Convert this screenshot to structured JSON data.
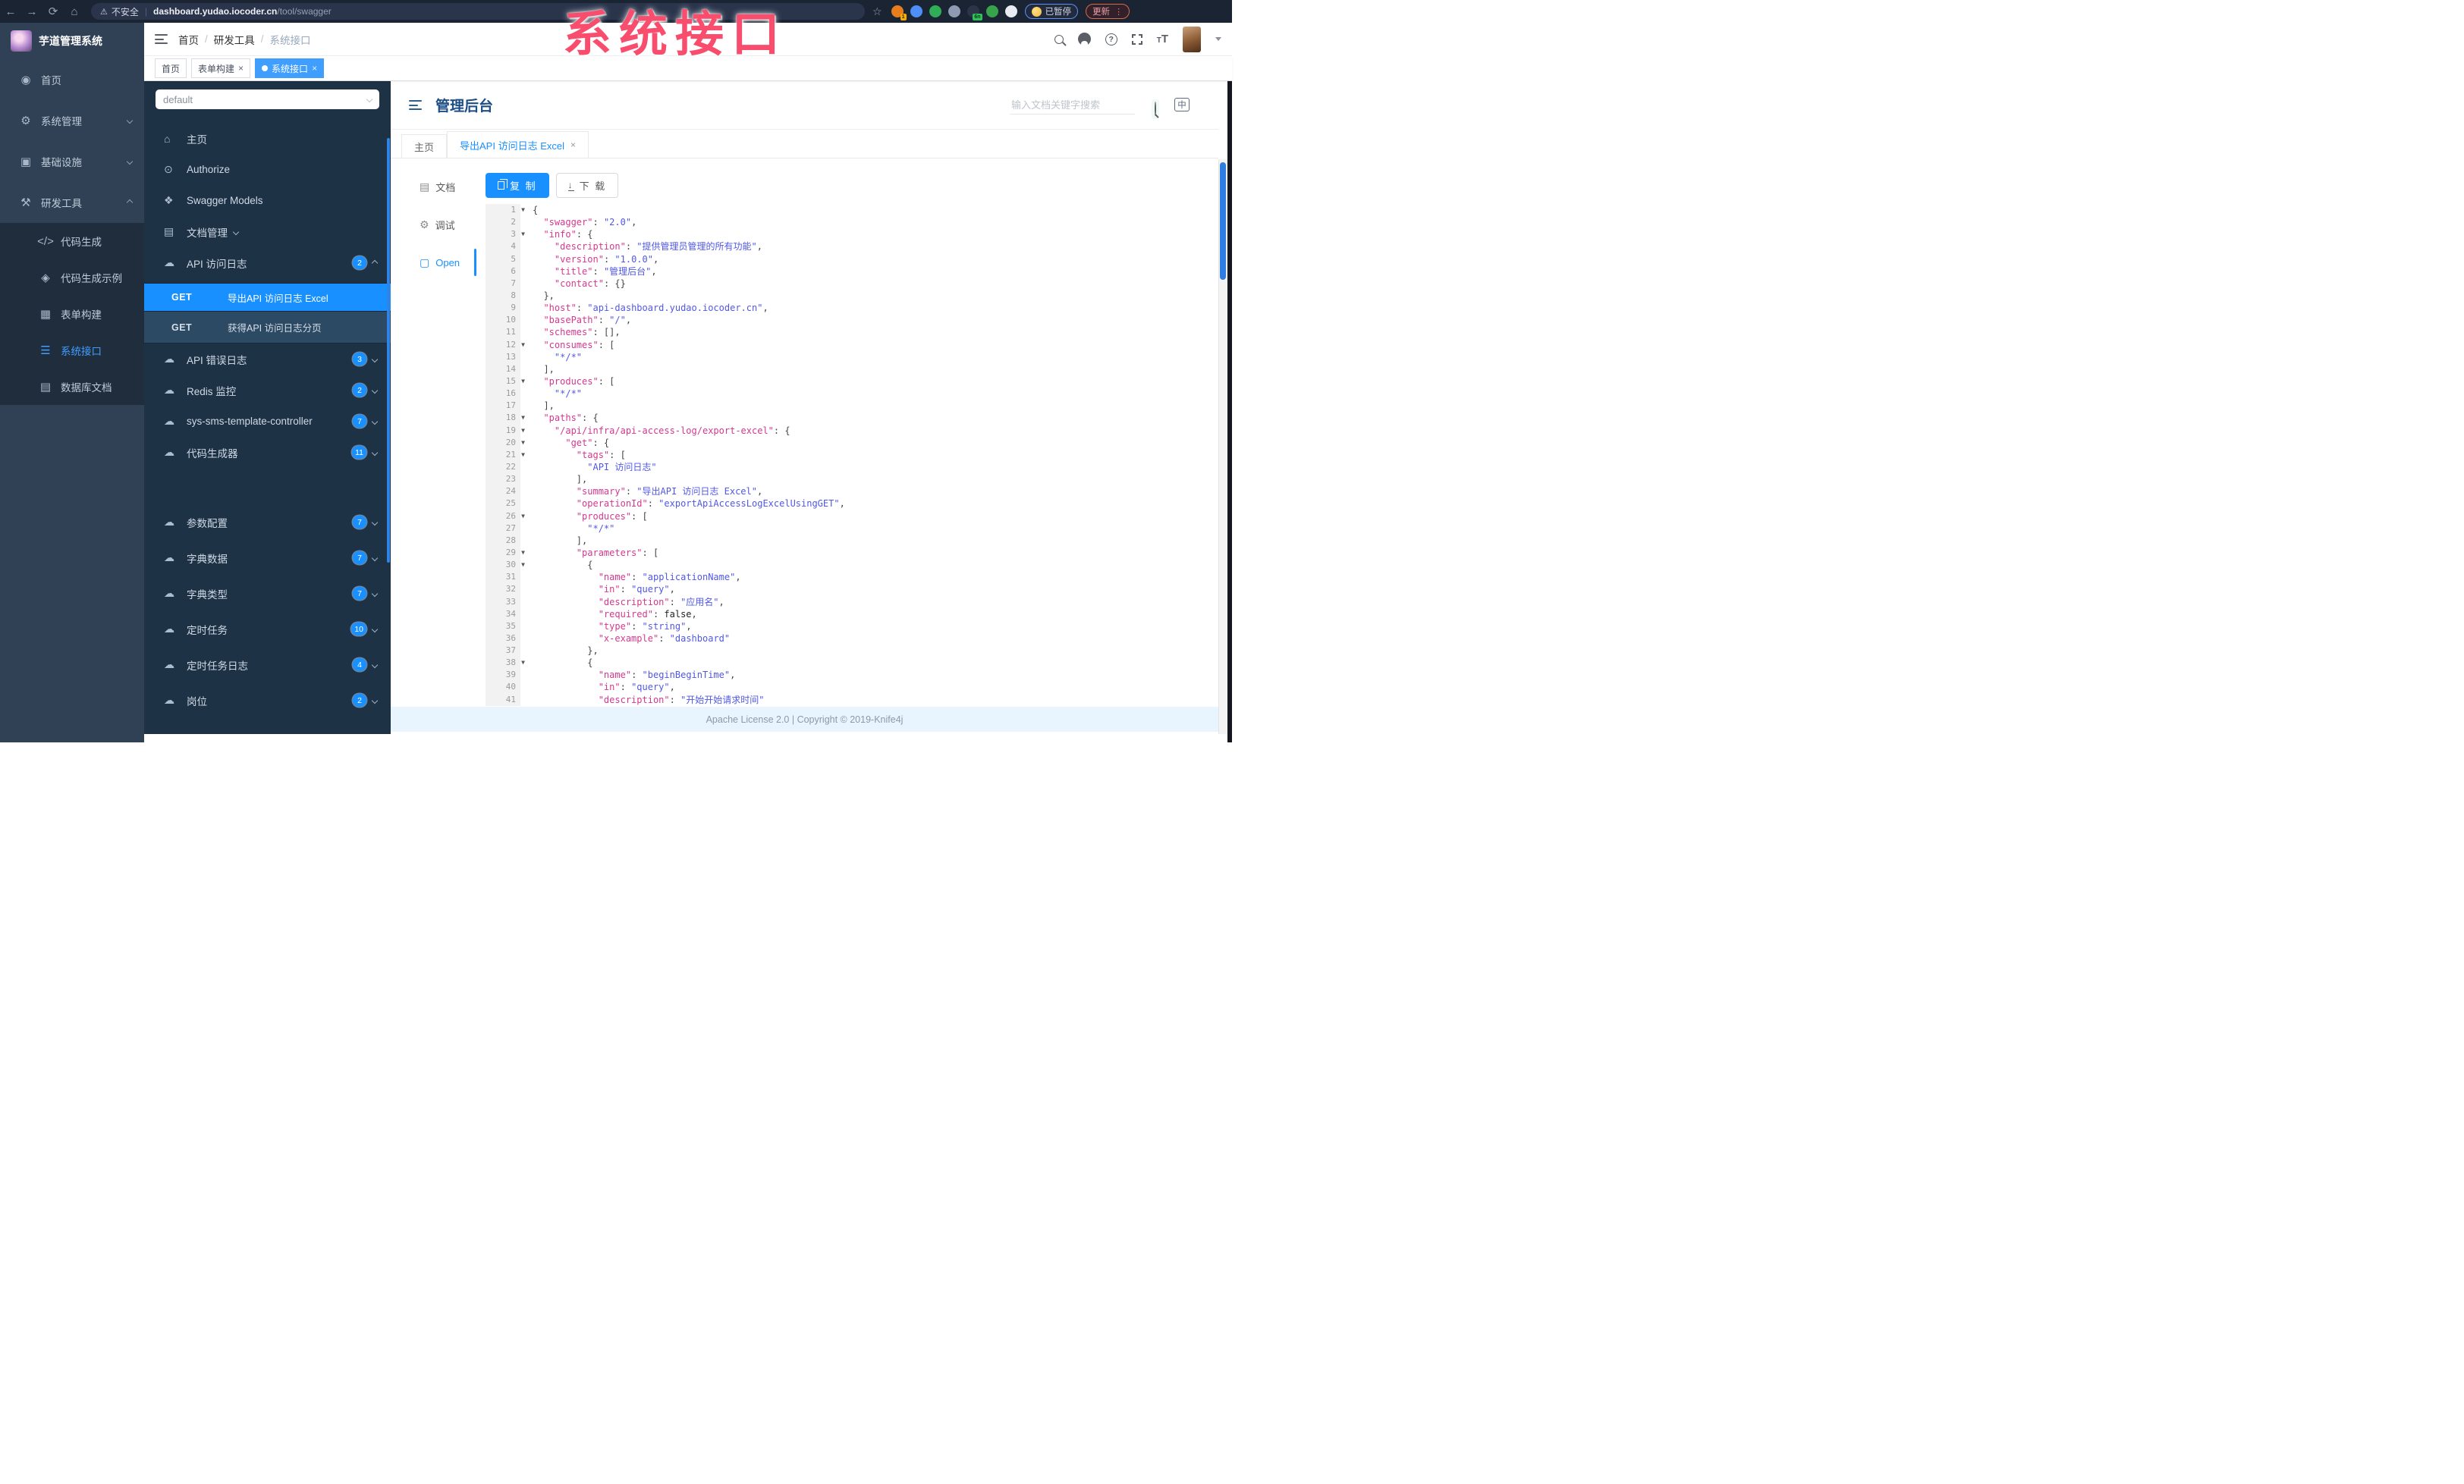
{
  "watermark": {
    "text": "系统接口",
    "color": "#f94d6e"
  },
  "browser": {
    "security_label": "不安全",
    "url_host": "dashboard.yudao.iocoder.cn",
    "url_path": "/tool/swagger",
    "paused_label": "已暂停",
    "update_label": "更新",
    "extensions": [
      {
        "name": "extension-orange",
        "color": "#e87d1e",
        "badge": "1",
        "badge_style": "orange"
      },
      {
        "name": "extension-drop",
        "color": "#4f8ef7"
      },
      {
        "name": "extension-shield-green",
        "color": "#2fae57"
      },
      {
        "name": "extension-grid",
        "color": "#8e9bb3"
      },
      {
        "name": "extension-dark",
        "color": "#2c3547",
        "badge": "6n",
        "badge_style": "green"
      },
      {
        "name": "extension-leaf",
        "color": "#37a34a"
      },
      {
        "name": "extension-paw",
        "color": "#e8ecf2"
      }
    ]
  },
  "app": {
    "logo_title": "芋道管理系统",
    "sidebar": [
      {
        "label": "首页",
        "icon": "dashboard-icon",
        "glyph": "◉"
      },
      {
        "label": "系统管理",
        "icon": "gear-icon",
        "glyph": "⚙",
        "chevron": "down"
      },
      {
        "label": "基础设施",
        "icon": "monitor-icon",
        "glyph": "▣",
        "chevron": "down"
      },
      {
        "label": "研发工具",
        "icon": "toolbox-icon",
        "glyph": "⚒",
        "chevron": "up",
        "children": [
          {
            "label": "代码生成",
            "icon": "code-icon",
            "glyph": "</>"
          },
          {
            "label": "代码生成示例",
            "icon": "shield-check-icon",
            "glyph": "◈"
          },
          {
            "label": "表单构建",
            "icon": "form-grid-icon",
            "glyph": "▦"
          },
          {
            "label": "系统接口",
            "icon": "api-list-icon",
            "glyph": "☰",
            "active": true
          },
          {
            "label": "数据库文档",
            "icon": "table-icon",
            "glyph": "▤"
          }
        ]
      }
    ],
    "breadcrumb": [
      "首页",
      "研发工具",
      "系统接口"
    ],
    "view_tabs": [
      {
        "label": "首页",
        "closable": false,
        "active": false
      },
      {
        "label": "表单构建",
        "closable": true,
        "active": false
      },
      {
        "label": "系统接口",
        "closable": true,
        "active": true
      }
    ]
  },
  "knife4j": {
    "group_select": "default",
    "menu": [
      {
        "label": "主页",
        "icon": "home-icon",
        "glyph": "⌂"
      },
      {
        "label": "Authorize",
        "icon": "lock-icon",
        "glyph": "⊙"
      },
      {
        "label": "Swagger Models",
        "icon": "models-icon",
        "glyph": "❖"
      },
      {
        "label": "文档管理",
        "icon": "doc-manage-icon",
        "glyph": "▤",
        "chevron": "down"
      },
      {
        "label": "API 访问日志",
        "icon": "cloud-icon",
        "glyph": "☁",
        "badge": "2",
        "chevron": "up"
      }
    ],
    "operations": [
      {
        "method": "GET",
        "label": "导出API 访问日志 Excel",
        "selected": true
      },
      {
        "method": "GET",
        "label": "获得API 访问日志分页",
        "selected": false
      }
    ],
    "api_groups": [
      {
        "label": "API 错误日志",
        "badge": "3"
      },
      {
        "label": "Redis 监控",
        "badge": "2"
      },
      {
        "label": "sys-sms-template-controller",
        "badge": "7"
      },
      {
        "label": "代码生成器",
        "badge": "11"
      },
      {
        "label": "参数配置",
        "badge": "7"
      },
      {
        "label": "字典数据",
        "badge": "7"
      },
      {
        "label": "字典类型",
        "badge": "7"
      },
      {
        "label": "定时任务",
        "badge": "10"
      },
      {
        "label": "定时任务日志",
        "badge": "4"
      },
      {
        "label": "岗位",
        "badge": "2"
      }
    ],
    "doc_header": {
      "title": "管理后台",
      "search_placeholder": "输入文档关键字搜索",
      "lang_label": "中"
    },
    "doc_tabs": [
      {
        "label": "主页",
        "closable": false,
        "active": false
      },
      {
        "label": "导出API 访问日志 Excel",
        "closable": true,
        "active": true
      }
    ],
    "mini_tabs": [
      {
        "label": "文档",
        "icon": "doc-icon",
        "glyph": "▤",
        "active": false
      },
      {
        "label": "调试",
        "icon": "debug-icon",
        "glyph": "⚙",
        "active": false
      },
      {
        "label": "Open",
        "icon": "open-file-icon",
        "glyph": "▢",
        "active": true
      }
    ],
    "toolbar": {
      "copy_label": "复 制",
      "download_label": "下 载"
    },
    "footer": "Apache License 2.0 | Copyright © 2019-Knife4j"
  },
  "editor": {
    "lines": [
      {
        "n": 1,
        "f": 1,
        "p": [
          [
            "p",
            "{"
          ]
        ]
      },
      {
        "n": 2,
        "p": [
          [
            "p",
            "  "
          ],
          [
            "k",
            "\"swagger\""
          ],
          [
            "p",
            ": "
          ],
          [
            "s",
            "\"2.0\""
          ],
          [
            "p",
            ","
          ]
        ]
      },
      {
        "n": 3,
        "f": 1,
        "p": [
          [
            "p",
            "  "
          ],
          [
            "k",
            "\"info\""
          ],
          [
            "p",
            ": {"
          ]
        ]
      },
      {
        "n": 4,
        "p": [
          [
            "p",
            "    "
          ],
          [
            "k",
            "\"description\""
          ],
          [
            "p",
            ": "
          ],
          [
            "s",
            "\"提供管理员管理的所有功能\""
          ],
          [
            "p",
            ","
          ]
        ]
      },
      {
        "n": 5,
        "p": [
          [
            "p",
            "    "
          ],
          [
            "k",
            "\"version\""
          ],
          [
            "p",
            ": "
          ],
          [
            "s",
            "\"1.0.0\""
          ],
          [
            "p",
            ","
          ]
        ]
      },
      {
        "n": 6,
        "p": [
          [
            "p",
            "    "
          ],
          [
            "k",
            "\"title\""
          ],
          [
            "p",
            ": "
          ],
          [
            "s",
            "\"管理后台\""
          ],
          [
            "p",
            ","
          ]
        ]
      },
      {
        "n": 7,
        "p": [
          [
            "p",
            "    "
          ],
          [
            "k",
            "\"contact\""
          ],
          [
            "p",
            ": {}"
          ]
        ]
      },
      {
        "n": 8,
        "p": [
          [
            "p",
            "  },"
          ]
        ]
      },
      {
        "n": 9,
        "p": [
          [
            "p",
            "  "
          ],
          [
            "k",
            "\"host\""
          ],
          [
            "p",
            ": "
          ],
          [
            "s",
            "\"api-dashboard.yudao.iocoder.cn\""
          ],
          [
            "p",
            ","
          ]
        ]
      },
      {
        "n": 10,
        "p": [
          [
            "p",
            "  "
          ],
          [
            "k",
            "\"basePath\""
          ],
          [
            "p",
            ": "
          ],
          [
            "s",
            "\"/\""
          ],
          [
            "p",
            ","
          ]
        ]
      },
      {
        "n": 11,
        "p": [
          [
            "p",
            "  "
          ],
          [
            "k",
            "\"schemes\""
          ],
          [
            "p",
            ": [],"
          ]
        ]
      },
      {
        "n": 12,
        "f": 1,
        "p": [
          [
            "p",
            "  "
          ],
          [
            "k",
            "\"consumes\""
          ],
          [
            "p",
            ": ["
          ]
        ]
      },
      {
        "n": 13,
        "p": [
          [
            "p",
            "    "
          ],
          [
            "s",
            "\"*/*\""
          ]
        ]
      },
      {
        "n": 14,
        "p": [
          [
            "p",
            "  ],"
          ]
        ]
      },
      {
        "n": 15,
        "f": 1,
        "p": [
          [
            "p",
            "  "
          ],
          [
            "k",
            "\"produces\""
          ],
          [
            "p",
            ": ["
          ]
        ]
      },
      {
        "n": 16,
        "p": [
          [
            "p",
            "    "
          ],
          [
            "s",
            "\"*/*\""
          ]
        ]
      },
      {
        "n": 17,
        "p": [
          [
            "p",
            "  ],"
          ]
        ]
      },
      {
        "n": 18,
        "f": 1,
        "p": [
          [
            "p",
            "  "
          ],
          [
            "k",
            "\"paths\""
          ],
          [
            "p",
            ": {"
          ]
        ]
      },
      {
        "n": 19,
        "f": 1,
        "p": [
          [
            "p",
            "    "
          ],
          [
            "k",
            "\"/api/infra/api-access-log/export-excel\""
          ],
          [
            "p",
            ": {"
          ]
        ]
      },
      {
        "n": 20,
        "f": 1,
        "p": [
          [
            "p",
            "      "
          ],
          [
            "k",
            "\"get\""
          ],
          [
            "p",
            ": {"
          ]
        ]
      },
      {
        "n": 21,
        "f": 1,
        "p": [
          [
            "p",
            "        "
          ],
          [
            "k",
            "\"tags\""
          ],
          [
            "p",
            ": ["
          ]
        ]
      },
      {
        "n": 22,
        "p": [
          [
            "p",
            "          "
          ],
          [
            "s",
            "\"API 访问日志\""
          ]
        ]
      },
      {
        "n": 23,
        "p": [
          [
            "p",
            "        ],"
          ]
        ]
      },
      {
        "n": 24,
        "p": [
          [
            "p",
            "        "
          ],
          [
            "k",
            "\"summary\""
          ],
          [
            "p",
            ": "
          ],
          [
            "s",
            "\"导出API 访问日志 Excel\""
          ],
          [
            "p",
            ","
          ]
        ]
      },
      {
        "n": 25,
        "p": [
          [
            "p",
            "        "
          ],
          [
            "k",
            "\"operationId\""
          ],
          [
            "p",
            ": "
          ],
          [
            "s",
            "\"exportApiAccessLogExcelUsingGET\""
          ],
          [
            "p",
            ","
          ]
        ]
      },
      {
        "n": 26,
        "f": 1,
        "p": [
          [
            "p",
            "        "
          ],
          [
            "k",
            "\"produces\""
          ],
          [
            "p",
            ": ["
          ]
        ]
      },
      {
        "n": 27,
        "p": [
          [
            "p",
            "          "
          ],
          [
            "s",
            "\"*/*\""
          ]
        ]
      },
      {
        "n": 28,
        "p": [
          [
            "p",
            "        ],"
          ]
        ]
      },
      {
        "n": 29,
        "f": 1,
        "p": [
          [
            "p",
            "        "
          ],
          [
            "k",
            "\"parameters\""
          ],
          [
            "p",
            ": ["
          ]
        ]
      },
      {
        "n": 30,
        "f": 1,
        "p": [
          [
            "p",
            "          {"
          ]
        ]
      },
      {
        "n": 31,
        "p": [
          [
            "p",
            "            "
          ],
          [
            "k",
            "\"name\""
          ],
          [
            "p",
            ": "
          ],
          [
            "s",
            "\"applicationName\""
          ],
          [
            "p",
            ","
          ]
        ]
      },
      {
        "n": 32,
        "p": [
          [
            "p",
            "            "
          ],
          [
            "k",
            "\"in\""
          ],
          [
            "p",
            ": "
          ],
          [
            "s",
            "\"query\""
          ],
          [
            "p",
            ","
          ]
        ]
      },
      {
        "n": 33,
        "p": [
          [
            "p",
            "            "
          ],
          [
            "k",
            "\"description\""
          ],
          [
            "p",
            ": "
          ],
          [
            "s",
            "\"应用名\""
          ],
          [
            "p",
            ","
          ]
        ]
      },
      {
        "n": 34,
        "p": [
          [
            "p",
            "            "
          ],
          [
            "k",
            "\"required\""
          ],
          [
            "p",
            ": "
          ],
          [
            "b",
            "false"
          ],
          [
            "p",
            ","
          ]
        ]
      },
      {
        "n": 35,
        "p": [
          [
            "p",
            "            "
          ],
          [
            "k",
            "\"type\""
          ],
          [
            "p",
            ": "
          ],
          [
            "s",
            "\"string\""
          ],
          [
            "p",
            ","
          ]
        ]
      },
      {
        "n": 36,
        "p": [
          [
            "p",
            "            "
          ],
          [
            "k",
            "\"x-example\""
          ],
          [
            "p",
            ": "
          ],
          [
            "s",
            "\"dashboard\""
          ]
        ]
      },
      {
        "n": 37,
        "p": [
          [
            "p",
            "          },"
          ]
        ]
      },
      {
        "n": 38,
        "f": 1,
        "p": [
          [
            "p",
            "          {"
          ]
        ]
      },
      {
        "n": 39,
        "p": [
          [
            "p",
            "            "
          ],
          [
            "k",
            "\"name\""
          ],
          [
            "p",
            ": "
          ],
          [
            "s",
            "\"beginBeginTime\""
          ],
          [
            "p",
            ","
          ]
        ]
      },
      {
        "n": 40,
        "p": [
          [
            "p",
            "            "
          ],
          [
            "k",
            "\"in\""
          ],
          [
            "p",
            ": "
          ],
          [
            "s",
            "\"query\""
          ],
          [
            "p",
            ","
          ]
        ]
      },
      {
        "n": 41,
        "p": [
          [
            "p",
            "            "
          ],
          [
            "k",
            "\"description\""
          ],
          [
            "p",
            ": "
          ],
          [
            "s",
            "\"开始开始请求时间\""
          ]
        ]
      }
    ]
  }
}
